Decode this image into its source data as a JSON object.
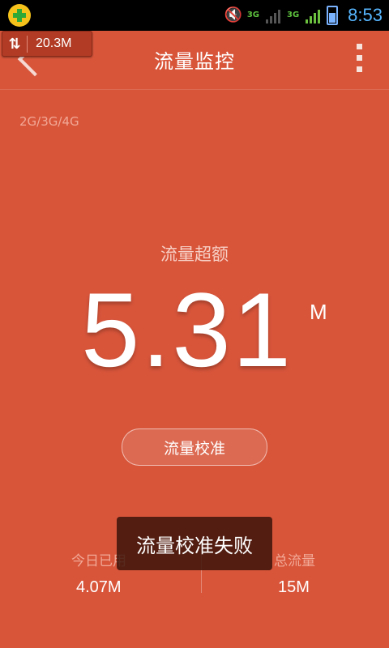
{
  "status_bar": {
    "time": "8:53",
    "network_type": "3G",
    "network_type_2": "3G",
    "icons": [
      "app-plus-icon",
      "mute-icon",
      "3g-data-icon",
      "signal-icon",
      "battery-icon"
    ]
  },
  "speed_badge": {
    "arrows": "⇅",
    "value": "20.3M"
  },
  "header": {
    "title": "流量监控"
  },
  "network_label": "2G/3G/4G",
  "main": {
    "status_label": "流量超额",
    "value": "5.31",
    "unit": "M",
    "calibrate_button": "流量校准"
  },
  "stats": {
    "today_label": "今日已用",
    "today_value": "4.07M",
    "total_label": "总流量",
    "total_value": "15M"
  },
  "toast": "流量校准失败",
  "colors": {
    "background": "#d8553a",
    "accent_text": "#f1a896",
    "status_time": "#57b6ff"
  }
}
